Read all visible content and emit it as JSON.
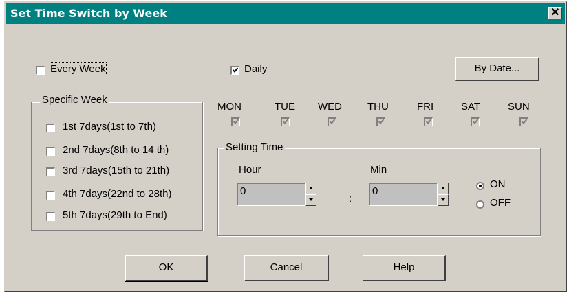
{
  "window": {
    "title": "Set Time Switch by Week",
    "close_glyph": "✕"
  },
  "every_week": {
    "label": "Every Week",
    "checked": false
  },
  "daily": {
    "label": "Daily",
    "checked": true
  },
  "by_date_button": {
    "label": "By Date..."
  },
  "specific_week": {
    "title": "Specific Week",
    "items": [
      {
        "label": "1st 7days(1st to 7th)"
      },
      {
        "label": "2nd 7days(8th to 14 th)"
      },
      {
        "label": "3rd 7days(15th to 21th)"
      },
      {
        "label": "4th 7days(22nd to 28th)"
      },
      {
        "label": "5th 7days(29th to End)"
      }
    ]
  },
  "days": [
    {
      "label": "MON"
    },
    {
      "label": "TUE"
    },
    {
      "label": "WED"
    },
    {
      "label": "THU"
    },
    {
      "label": "FRI"
    },
    {
      "label": "SAT"
    },
    {
      "label": "SUN"
    }
  ],
  "setting_time": {
    "title": "Setting Time",
    "hour_label": "Hour",
    "hour_value": "0",
    "min_label": "Min",
    "min_value": "0",
    "separator": ":",
    "on_label": "ON",
    "off_label": "OFF",
    "selected": "ON"
  },
  "buttons": {
    "ok": "OK",
    "cancel": "Cancel",
    "help": "Help"
  },
  "colors": {
    "titlebar": "#008080",
    "face": "#d4d0c8"
  }
}
